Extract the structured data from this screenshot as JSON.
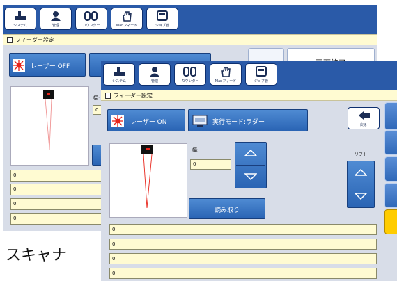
{
  "toolbar": {
    "system": "システム",
    "manage": "管理",
    "counter": "カウンター",
    "manual_feed": "Manフィード",
    "job_manage": "ジョブ管"
  },
  "background_window": {
    "title": "フィーダー設定",
    "laser_button": "レーザー OFF",
    "screen_end": "画面終了",
    "width_label": "幅:",
    "width_value": "0",
    "list_values": [
      "0",
      "0",
      "0",
      "0"
    ]
  },
  "foreground_window": {
    "title": "フィーダー設定",
    "laser_button": "レーザー ON",
    "mode_button": "実行モード:ラダー",
    "back_label": "戻る",
    "width_label": "幅:",
    "width_value": "0",
    "lift_label": "リフト",
    "read_button": "読み取り",
    "list_values": [
      "0",
      "0",
      "0",
      "0"
    ]
  },
  "caption": "スキャナ",
  "colors": {
    "window_blue": "#2a5aa8",
    "field_yellow": "#fffbd2",
    "accent_yellow": "#ffcc00",
    "laser_red": "#e8241a"
  }
}
